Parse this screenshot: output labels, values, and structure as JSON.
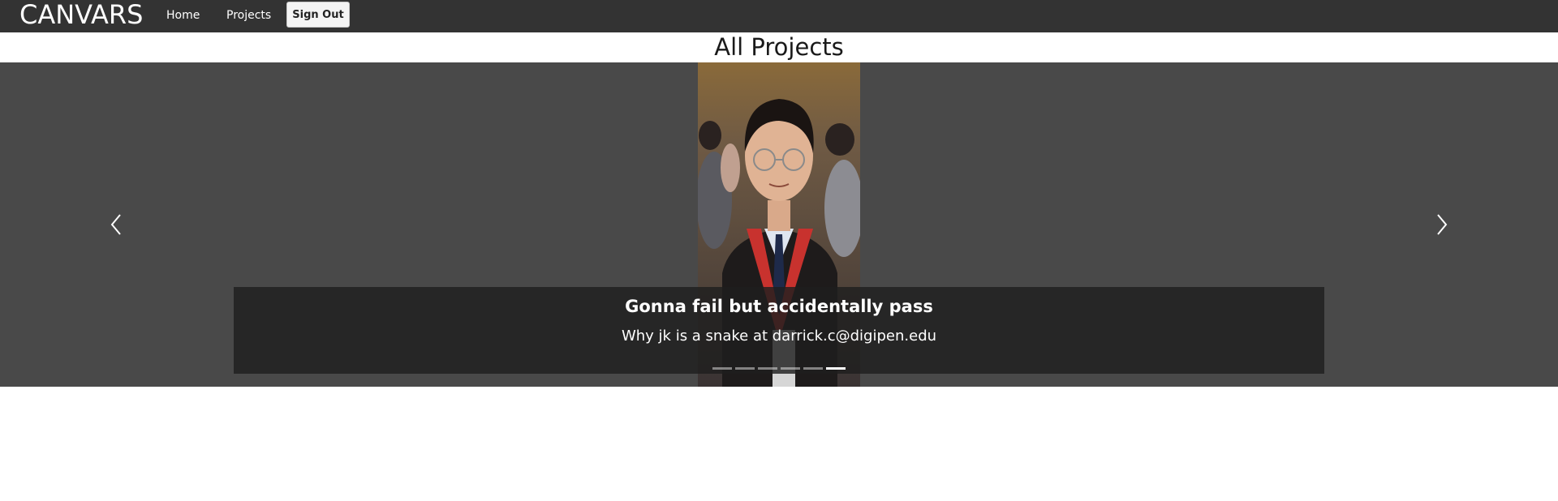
{
  "navbar": {
    "brand": "CANVARS",
    "links": [
      "Home",
      "Projects"
    ],
    "signout_label": "Sign Out"
  },
  "page_title": "All Projects",
  "carousel": {
    "active_slide": {
      "caption_title": "Gonna fail but accidentally pass",
      "caption_text": "Why jk is a snake at darrick.c@digipen.edu"
    },
    "indicator_count": 6,
    "active_index": 5,
    "prev_icon": "chevron-left-icon",
    "next_icon": "chevron-right-icon"
  },
  "colors": {
    "navbar_bg": "#333333",
    "carousel_bg": "#494949",
    "caption_bg": "#1e1e1e"
  }
}
